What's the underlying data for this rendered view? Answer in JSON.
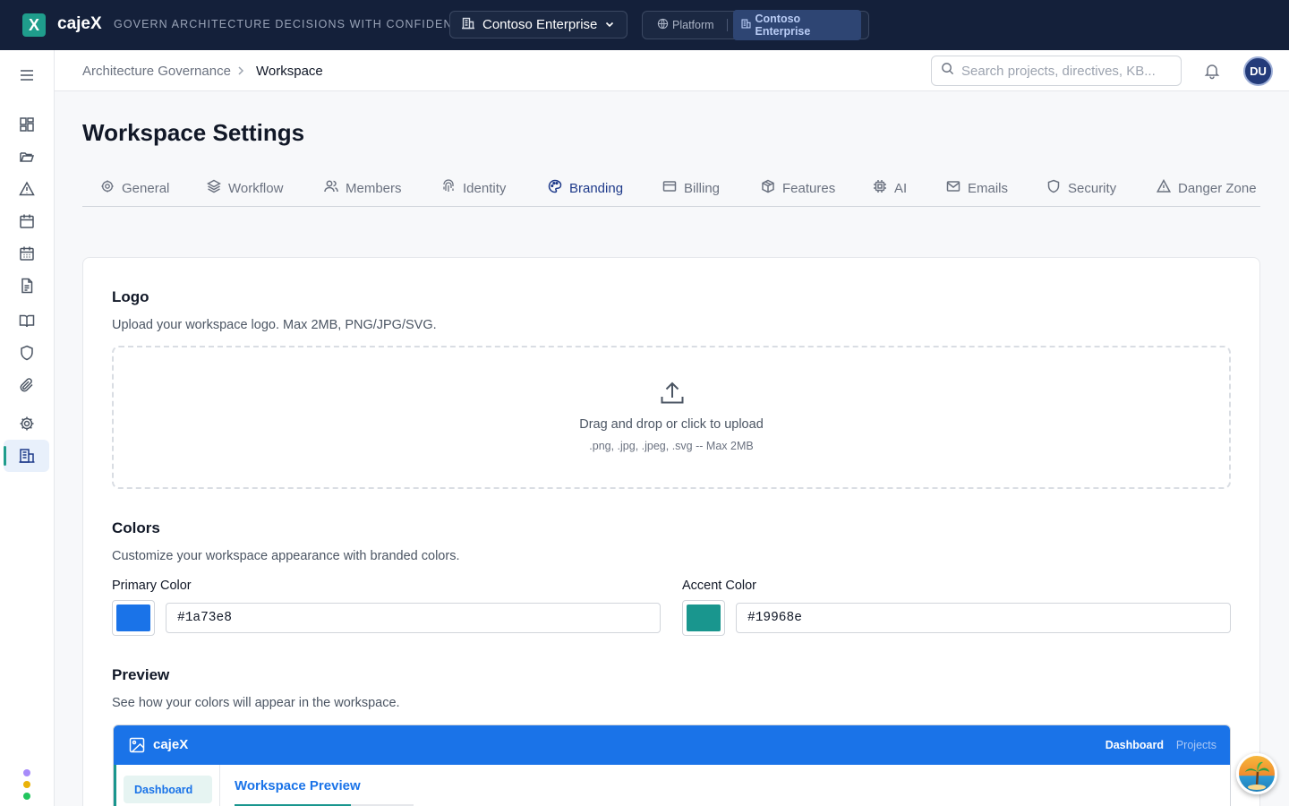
{
  "topbar": {
    "logo_letter": "X",
    "brand": "cajeX",
    "tagline": "GOVERN ARCHITECTURE DECISIONS WITH CONFIDENCE",
    "workspace_selector": "Contoso Enterprise",
    "context": {
      "platform": "Platform",
      "workspace": "Contoso Enterprise"
    }
  },
  "breadcrumb": {
    "parent": "Architecture Governance",
    "current": "Workspace"
  },
  "search": {
    "placeholder": "Search projects, directives, KB..."
  },
  "user": {
    "initials": "DU"
  },
  "page": {
    "title": "Workspace Settings"
  },
  "tabs": [
    {
      "label": "General",
      "icon": "gear-icon"
    },
    {
      "label": "Workflow",
      "icon": "layers-icon"
    },
    {
      "label": "Members",
      "icon": "users-icon"
    },
    {
      "label": "Identity",
      "icon": "fingerprint-icon"
    },
    {
      "label": "Branding",
      "icon": "palette-icon",
      "active": true
    },
    {
      "label": "Billing",
      "icon": "credit-card-icon"
    },
    {
      "label": "Features",
      "icon": "package-icon"
    },
    {
      "label": "AI",
      "icon": "cpu-icon"
    },
    {
      "label": "Emails",
      "icon": "mail-icon"
    },
    {
      "label": "Security",
      "icon": "shield-icon"
    },
    {
      "label": "Danger Zone",
      "icon": "warning-icon"
    }
  ],
  "logo_section": {
    "title": "Logo",
    "description": "Upload your workspace logo. Max 2MB, PNG/JPG/SVG.",
    "dropzone_main": "Drag and drop or click to upload",
    "dropzone_sub": ".png, .jpg, .jpeg, .svg -- Max 2MB"
  },
  "colors_section": {
    "title": "Colors",
    "description": "Customize your workspace appearance with branded colors.",
    "primary_label": "Primary Color",
    "primary_value": "#1a73e8",
    "accent_label": "Accent Color",
    "accent_value": "#19968e"
  },
  "preview_section": {
    "title": "Preview",
    "description": "See how your colors will appear in the workspace.",
    "brand": "cajeX",
    "nav_active": "Dashboard",
    "nav_other": "Projects",
    "side_item": "Dashboard",
    "content_title": "Workspace Preview",
    "progress": 0.65
  },
  "colors": {
    "topbar_bg": "#14203a",
    "logo_bg": "#1f9d8c",
    "avatar_bg": "#233b7a"
  }
}
